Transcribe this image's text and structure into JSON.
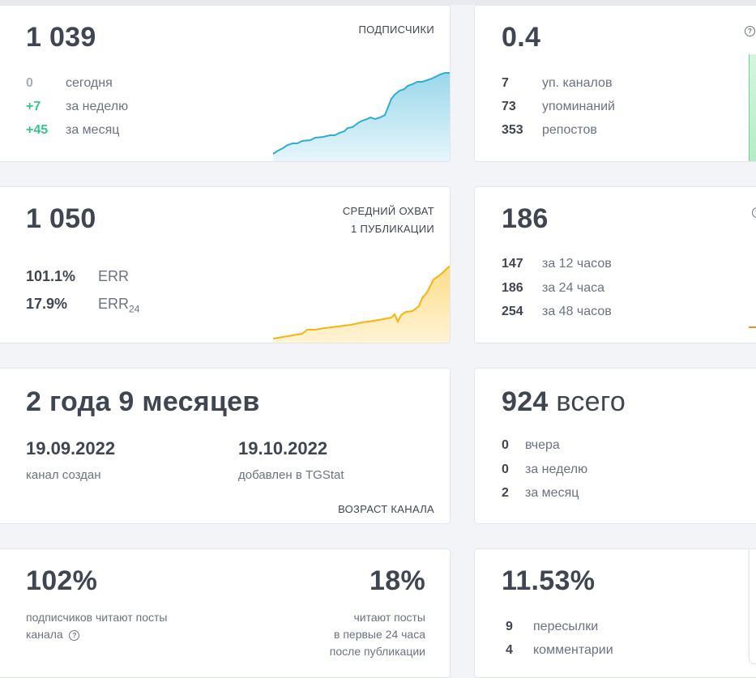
{
  "subscribers": {
    "total": "1 039",
    "label": "ПОДПИСЧИКИ",
    "rows": [
      {
        "value": "0",
        "label": "сегодня"
      },
      {
        "value": "+7",
        "label": "за неделю"
      },
      {
        "value": "+45",
        "label": "за месяц"
      }
    ],
    "chart_color": "#2eaed4"
  },
  "citation": {
    "index": "0.4",
    "rows": [
      {
        "value": "7",
        "label": "уп. каналов"
      },
      {
        "value": "73",
        "label": "упоминаний"
      },
      {
        "value": "353",
        "label": "репостов"
      }
    ]
  },
  "reach": {
    "total": "1 050",
    "label_line1": "СРЕДНИЙ ОХВАТ",
    "label_line2": "1 ПУБЛИКАЦИИ",
    "err": {
      "value": "101.1%",
      "label": "ERR"
    },
    "err24": {
      "value": "17.9%",
      "label": "ERR",
      "sub": "24"
    },
    "chart_color": "#f5b50f"
  },
  "views": {
    "total": "186",
    "rows": [
      {
        "value": "147",
        "label": "за 12 часов"
      },
      {
        "value": "186",
        "label": "за 24 часа"
      },
      {
        "value": "254",
        "label": "за 48 часов"
      }
    ]
  },
  "age": {
    "text": "2 года 9 месяцев",
    "created_date": "19.09.2022",
    "created_label": "канал создан",
    "added_date": "19.10.2022",
    "added_label": "добавлен в TGStat",
    "footer": "ВОЗРАСТ КАНАЛА"
  },
  "posts": {
    "total": "924",
    "total_suffix": "всего",
    "rows": [
      {
        "value": "0",
        "label": "вчера"
      },
      {
        "value": "0",
        "label": "за неделю"
      },
      {
        "value": "2",
        "label": "за месяц"
      }
    ]
  },
  "reading": {
    "left_value": "102%",
    "left_line1": "подписчиков читают посты",
    "left_line2": "канала",
    "right_value": "18%",
    "right_line1": "читают посты",
    "right_line2": "в первые 24 часа",
    "right_line3": "после публикации"
  },
  "engagement": {
    "value": "11.53%",
    "rows": [
      {
        "value": "9",
        "label": "пересылки"
      },
      {
        "value": "4",
        "label": "комментарии"
      }
    ]
  },
  "icons": {
    "help": "help-circle-icon"
  }
}
